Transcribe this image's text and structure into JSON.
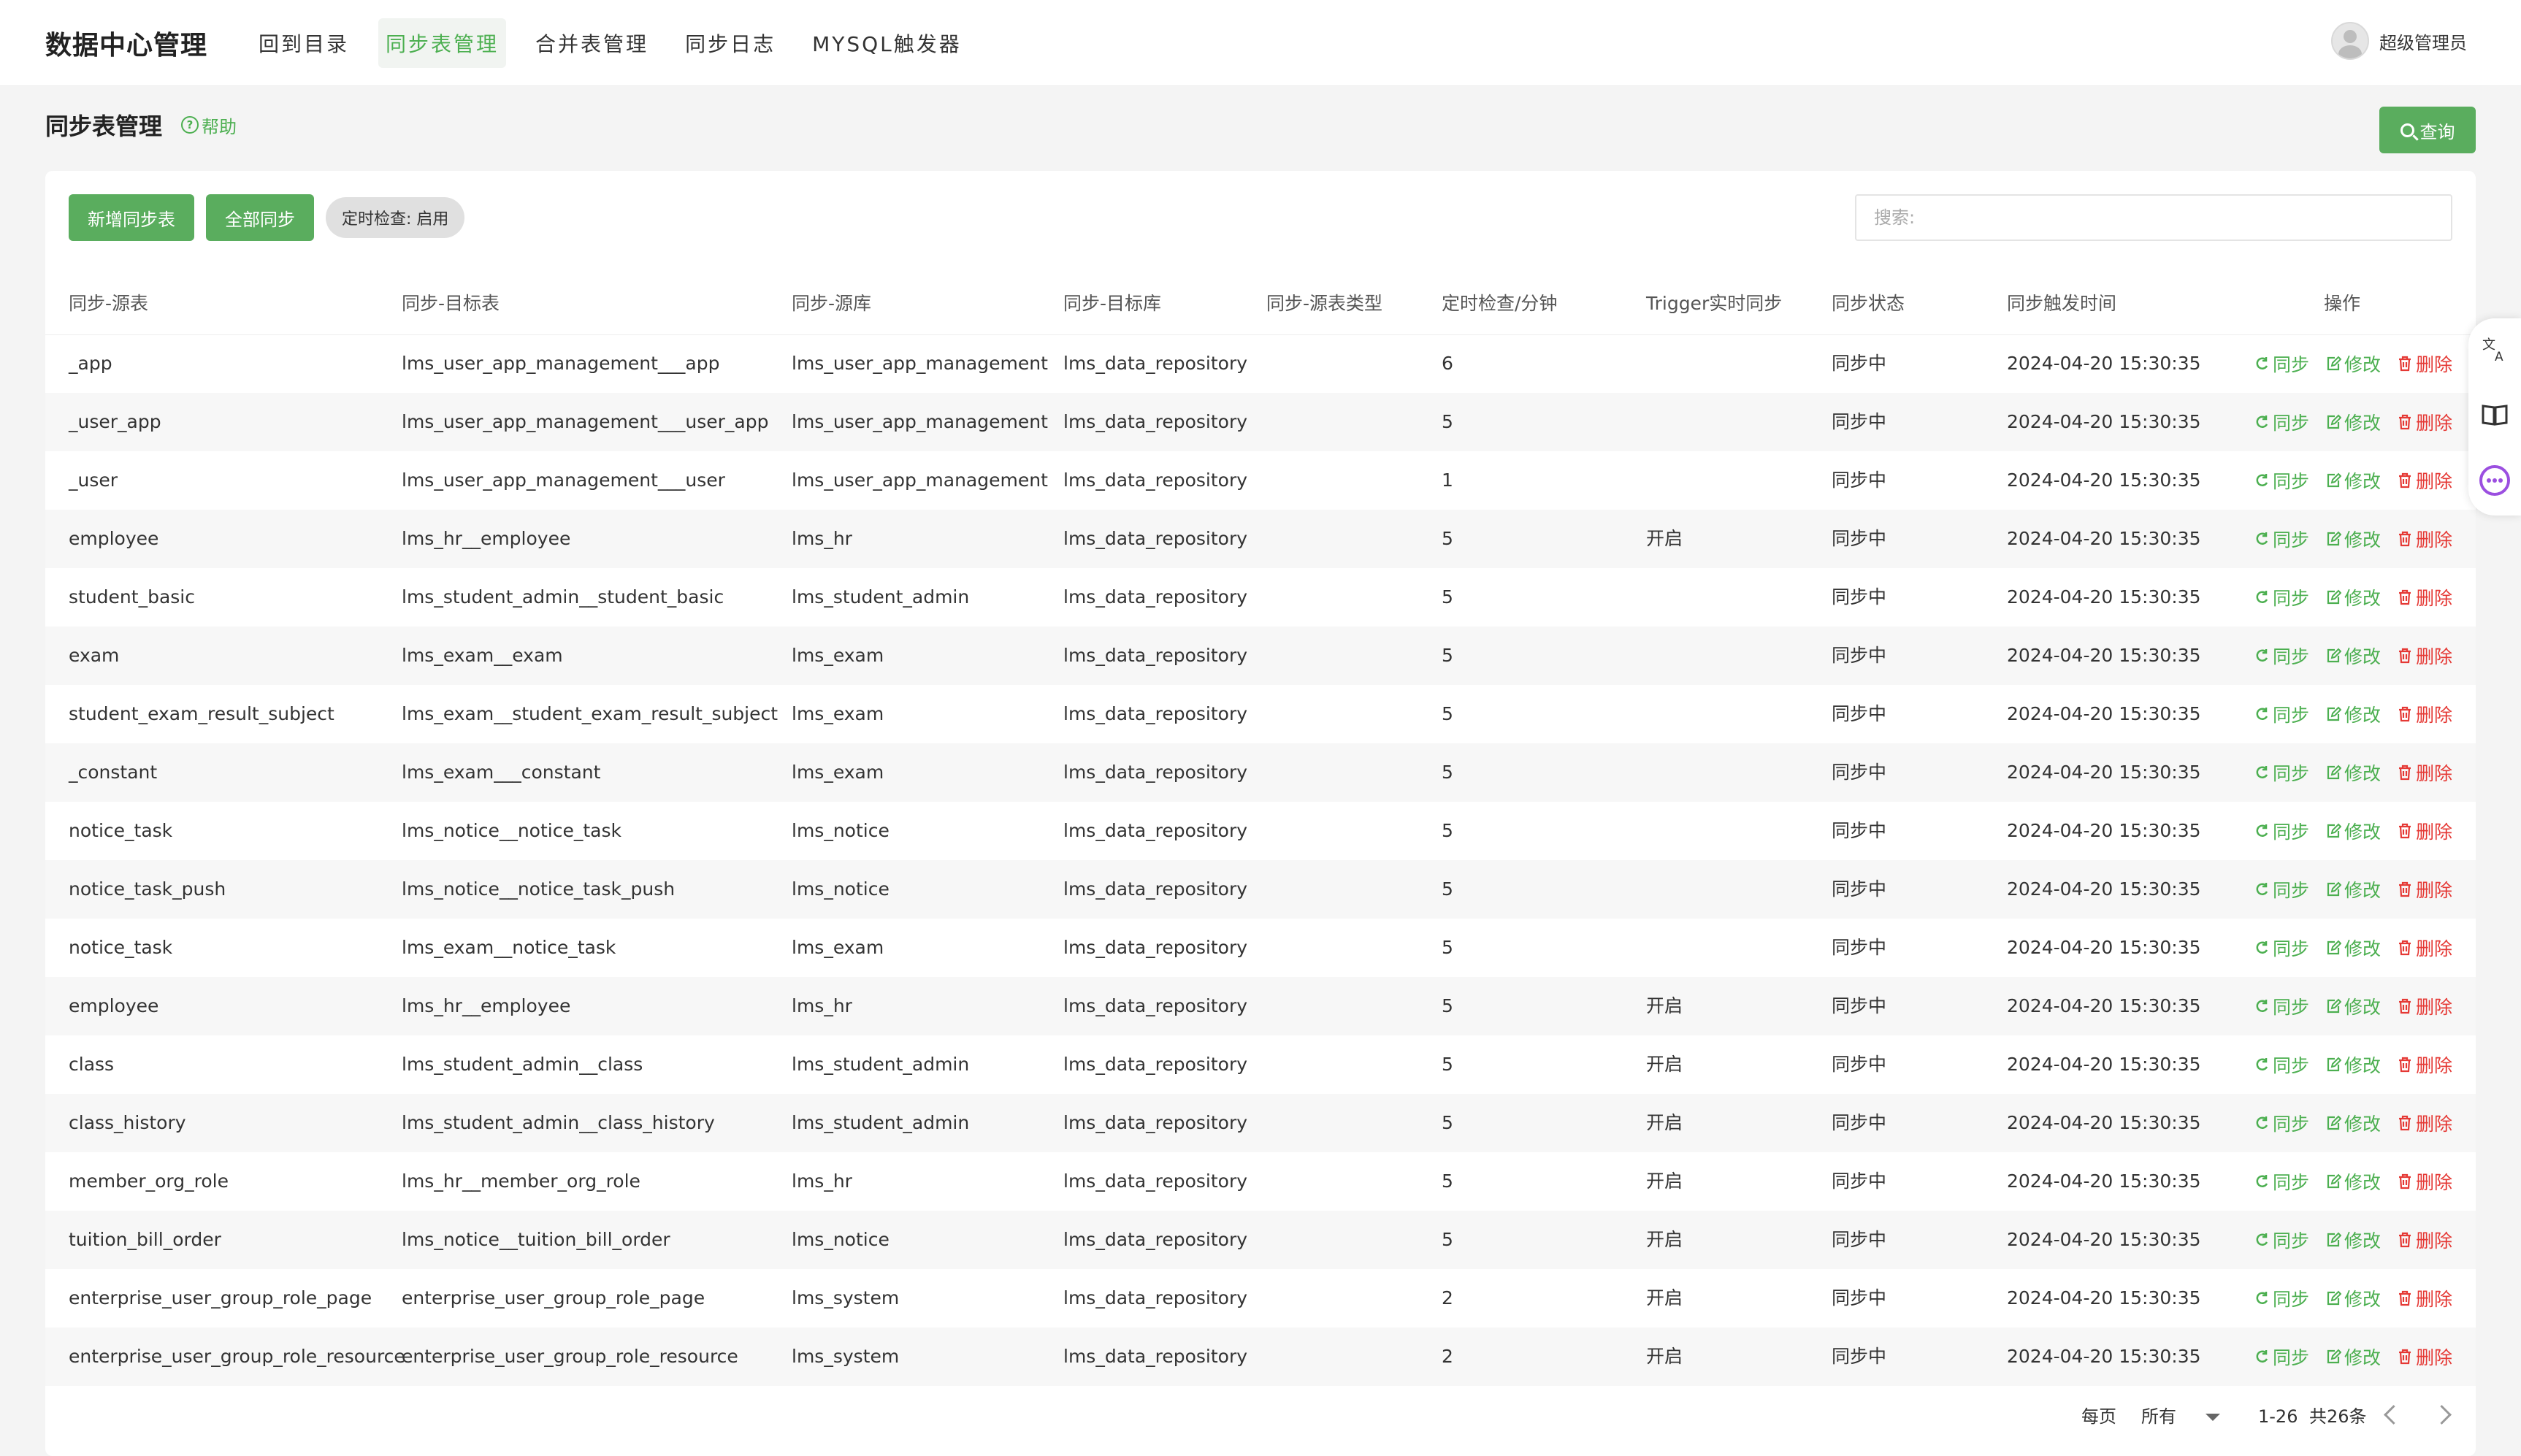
{
  "app": {
    "title": "数据中心管理",
    "nav": [
      "回到目录",
      "同步表管理",
      "合并表管理",
      "同步日志",
      "MYSQL触发器"
    ],
    "active_nav": 1,
    "user": "超级管理员"
  },
  "page": {
    "title": "同步表管理",
    "help": "帮助",
    "query_label": "查询"
  },
  "toolbar": {
    "add_label": "新增同步表",
    "sync_all_label": "全部同步",
    "timer_chip": "定时检查: 启用",
    "search_placeholder": "搜索:"
  },
  "table": {
    "columns": [
      "同步-源表",
      "同步-目标表",
      "同步-源库",
      "同步-目标库",
      "同步-源表类型",
      "定时检查/分钟",
      "Trigger实时同步",
      "同步状态",
      "同步触发时间",
      "操作"
    ],
    "actions": {
      "sync": "同步",
      "edit": "修改",
      "delete": "删除"
    },
    "rows": [
      {
        "src": "_app",
        "target": "lms_user_app_management___app",
        "src_db": "lms_user_app_management",
        "target_db": "lms_data_repository",
        "type": "",
        "interval": "6",
        "trigger": "",
        "status": "同步中",
        "time": "2024-04-20 15:30:35"
      },
      {
        "src": "_user_app",
        "target": "lms_user_app_management___user_app",
        "src_db": "lms_user_app_management",
        "target_db": "lms_data_repository",
        "type": "",
        "interval": "5",
        "trigger": "",
        "status": "同步中",
        "time": "2024-04-20 15:30:35"
      },
      {
        "src": "_user",
        "target": "lms_user_app_management___user",
        "src_db": "lms_user_app_management",
        "target_db": "lms_data_repository",
        "type": "",
        "interval": "1",
        "trigger": "",
        "status": "同步中",
        "time": "2024-04-20 15:30:35"
      },
      {
        "src": "employee",
        "target": "lms_hr__employee",
        "src_db": "lms_hr",
        "target_db": "lms_data_repository",
        "type": "",
        "interval": "5",
        "trigger": "开启",
        "status": "同步中",
        "time": "2024-04-20 15:30:35"
      },
      {
        "src": "student_basic",
        "target": "lms_student_admin__student_basic",
        "src_db": "lms_student_admin",
        "target_db": "lms_data_repository",
        "type": "",
        "interval": "5",
        "trigger": "",
        "status": "同步中",
        "time": "2024-04-20 15:30:35"
      },
      {
        "src": "exam",
        "target": "lms_exam__exam",
        "src_db": "lms_exam",
        "target_db": "lms_data_repository",
        "type": "",
        "interval": "5",
        "trigger": "",
        "status": "同步中",
        "time": "2024-04-20 15:30:35"
      },
      {
        "src": "student_exam_result_subject",
        "target": "lms_exam__student_exam_result_subject",
        "src_db": "lms_exam",
        "target_db": "lms_data_repository",
        "type": "",
        "interval": "5",
        "trigger": "",
        "status": "同步中",
        "time": "2024-04-20 15:30:35"
      },
      {
        "src": "_constant",
        "target": "lms_exam___constant",
        "src_db": "lms_exam",
        "target_db": "lms_data_repository",
        "type": "",
        "interval": "5",
        "trigger": "",
        "status": "同步中",
        "time": "2024-04-20 15:30:35"
      },
      {
        "src": "notice_task",
        "target": "lms_notice__notice_task",
        "src_db": "lms_notice",
        "target_db": "lms_data_repository",
        "type": "",
        "interval": "5",
        "trigger": "",
        "status": "同步中",
        "time": "2024-04-20 15:30:35"
      },
      {
        "src": "notice_task_push",
        "target": "lms_notice__notice_task_push",
        "src_db": "lms_notice",
        "target_db": "lms_data_repository",
        "type": "",
        "interval": "5",
        "trigger": "",
        "status": "同步中",
        "time": "2024-04-20 15:30:35"
      },
      {
        "src": "notice_task",
        "target": "lms_exam__notice_task",
        "src_db": "lms_exam",
        "target_db": "lms_data_repository",
        "type": "",
        "interval": "5",
        "trigger": "",
        "status": "同步中",
        "time": "2024-04-20 15:30:35"
      },
      {
        "src": "employee",
        "target": "lms_hr__employee",
        "src_db": "lms_hr",
        "target_db": "lms_data_repository",
        "type": "",
        "interval": "5",
        "trigger": "开启",
        "status": "同步中",
        "time": "2024-04-20 15:30:35"
      },
      {
        "src": "class",
        "target": "lms_student_admin__class",
        "src_db": "lms_student_admin",
        "target_db": "lms_data_repository",
        "type": "",
        "interval": "5",
        "trigger": "开启",
        "status": "同步中",
        "time": "2024-04-20 15:30:35"
      },
      {
        "src": "class_history",
        "target": "lms_student_admin__class_history",
        "src_db": "lms_student_admin",
        "target_db": "lms_data_repository",
        "type": "",
        "interval": "5",
        "trigger": "开启",
        "status": "同步中",
        "time": "2024-04-20 15:30:35"
      },
      {
        "src": "member_org_role",
        "target": "lms_hr__member_org_role",
        "src_db": "lms_hr",
        "target_db": "lms_data_repository",
        "type": "",
        "interval": "5",
        "trigger": "开启",
        "status": "同步中",
        "time": "2024-04-20 15:30:35"
      },
      {
        "src": "tuition_bill_order",
        "target": "lms_notice__tuition_bill_order",
        "src_db": "lms_notice",
        "target_db": "lms_data_repository",
        "type": "",
        "interval": "5",
        "trigger": "开启",
        "status": "同步中",
        "time": "2024-04-20 15:30:35"
      },
      {
        "src": "enterprise_user_group_role_page",
        "target": "enterprise_user_group_role_page",
        "src_db": "lms_system",
        "target_db": "lms_data_repository",
        "type": "",
        "interval": "2",
        "trigger": "开启",
        "status": "同步中",
        "time": "2024-04-20 15:30:35"
      },
      {
        "src": "enterprise_user_group_role_resource",
        "target": "enterprise_user_group_role_resource",
        "src_db": "lms_system",
        "target_db": "lms_data_repository",
        "type": "",
        "interval": "2",
        "trigger": "开启",
        "status": "同步中",
        "time": "2024-04-20 15:30:35"
      }
    ]
  },
  "pagination": {
    "per_page_label": "每页",
    "per_page_value": "所有",
    "range": "1-26",
    "total": "共26条"
  },
  "side_tools": [
    "translate-icon",
    "book-icon",
    "chat-icon"
  ],
  "colors": {
    "accent": "#4caf50",
    "primary_button": "#5aad5e",
    "danger": "#e53935"
  }
}
